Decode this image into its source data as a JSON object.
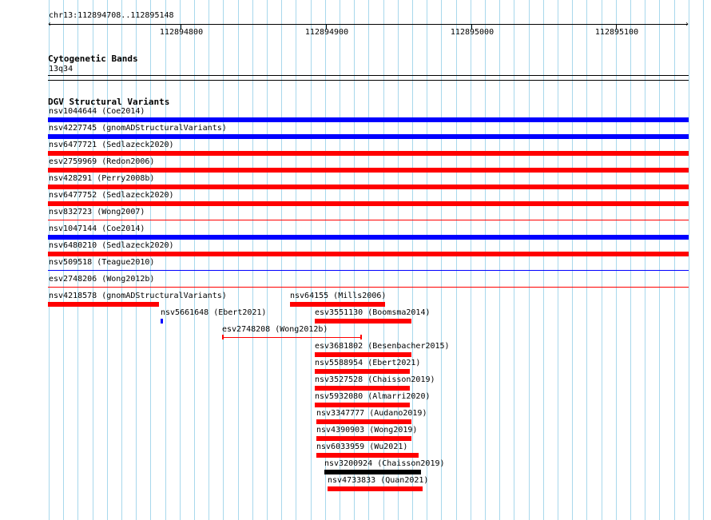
{
  "ruler": {
    "location": "chr13:112894708..112895148",
    "ticks": [
      "112894800",
      "112894900",
      "112895000",
      "112895100"
    ]
  },
  "cytoband": {
    "title": "Cytogenetic Bands",
    "band": "13q34"
  },
  "dgv": {
    "title": "DGV Structural Variants",
    "features": [
      {
        "id": "nsv1044644",
        "source": "Coe2014",
        "label": "nsv1044644 (Coe2014)",
        "color": "#0000ff"
      },
      {
        "id": "nsv4227745",
        "source": "gnomADStructuralVariants",
        "label": "nsv4227745 (gnomADStructuralVariants)",
        "color": "#0000ff"
      },
      {
        "id": "nsv6477721",
        "source": "Sedlazeck2020",
        "label": "nsv6477721 (Sedlazeck2020)",
        "color": "#ff0000"
      },
      {
        "id": "esv2759969",
        "source": "Redon2006",
        "label": "esv2759969 (Redon2006)",
        "color": "#ff0000"
      },
      {
        "id": "nsv428291",
        "source": "Perry2008b",
        "label": "nsv428291 (Perry2008b)",
        "color": "#ff0000"
      },
      {
        "id": "nsv6477752",
        "source": "Sedlazeck2020",
        "label": "nsv6477752 (Sedlazeck2020)",
        "color": "#ff0000"
      },
      {
        "id": "nsv832723",
        "source": "Wong2007",
        "label": "nsv832723 (Wong2007)",
        "color": "#ff0000"
      },
      {
        "id": "nsv1047144",
        "source": "Coe2014",
        "label": "nsv1047144 (Coe2014)",
        "color": "#0000ff"
      },
      {
        "id": "nsv6480210",
        "source": "Sedlazeck2020",
        "label": "nsv6480210 (Sedlazeck2020)",
        "color": "#ff0000"
      },
      {
        "id": "nsv509518",
        "source": "Teague2010",
        "label": "nsv509518 (Teague2010)",
        "color": "#0000ff"
      },
      {
        "id": "esv2748206",
        "source": "Wong2012b",
        "label": "esv2748206 (Wong2012b)",
        "color": "#ff0000"
      },
      {
        "id": "nsv4218578",
        "source": "gnomADStructuralVariants",
        "label": "nsv4218578 (gnomADStructuralVariants)",
        "color": "#ff0000"
      },
      {
        "id": "nsv64155",
        "source": "Mills2006",
        "label": "nsv64155 (Mills2006)",
        "color": "#ff0000"
      },
      {
        "id": "nsv5661648",
        "source": "Ebert2021",
        "label": "nsv5661648 (Ebert2021)",
        "color": "#0000ff"
      },
      {
        "id": "esv3551130",
        "source": "Boomsma2014",
        "label": "esv3551130 (Boomsma2014)",
        "color": "#ff0000"
      },
      {
        "id": "esv2748208",
        "source": "Wong2012b",
        "label": "esv2748208 (Wong2012b)",
        "color": "#ff0000"
      },
      {
        "id": "esv3681802",
        "source": "Besenbacher2015",
        "label": "esv3681802 (Besenbacher2015)",
        "color": "#ff0000"
      },
      {
        "id": "nsv5588954",
        "source": "Ebert2021",
        "label": "nsv5588954 (Ebert2021)",
        "color": "#ff0000"
      },
      {
        "id": "nsv3527528",
        "source": "Chaisson2019",
        "label": "nsv3527528 (Chaisson2019)",
        "color": "#ff0000"
      },
      {
        "id": "nsv5932080",
        "source": "Almarri2020",
        "label": "nsv5932080 (Almarri2020)",
        "color": "#ff0000"
      },
      {
        "id": "nsv3347777",
        "source": "Audano2019",
        "label": "nsv3347777 (Audano2019)",
        "color": "#ff0000"
      },
      {
        "id": "nsv4390903",
        "source": "Wong2019",
        "label": "nsv4390903 (Wong2019)",
        "color": "#ff0000"
      },
      {
        "id": "nsv6033959",
        "source": "Wu2021",
        "label": "nsv6033959 (Wu2021)",
        "color": "#ff0000"
      },
      {
        "id": "nsv3200924",
        "source": "Chaisson2019",
        "label": "nsv3200924 (Chaisson2019)",
        "color": "#000000"
      },
      {
        "id": "nsv4733833",
        "source": "Quan2021",
        "label": "nsv4733833 (Quan2021)",
        "color": "#ff0000"
      }
    ]
  }
}
